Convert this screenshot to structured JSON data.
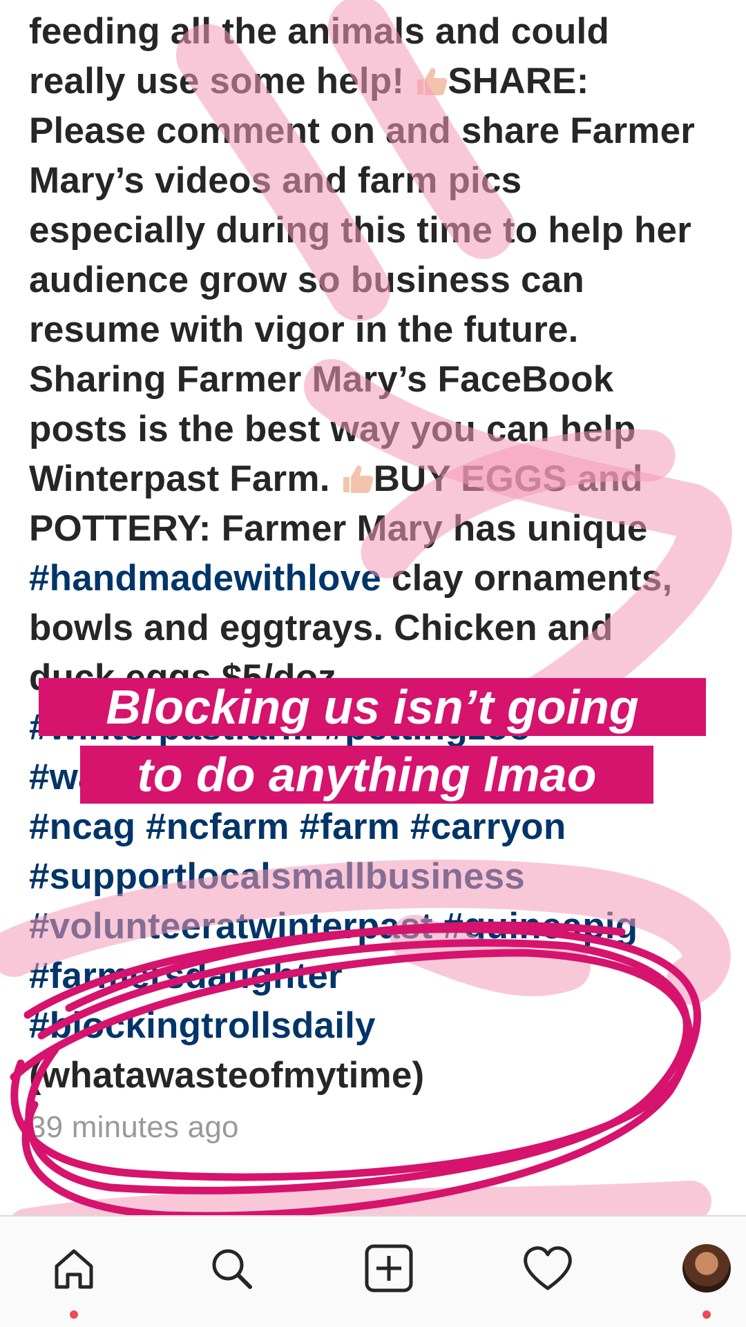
{
  "caption": {
    "lines": [
      [
        {
          "t": "feeding all the animals and could"
        }
      ],
      [
        {
          "t": "really use some help! "
        },
        {
          "emoji": "thumbs-up-icon"
        },
        {
          "t": "SHARE:"
        }
      ],
      [
        {
          "t": "Please comment on and share Farmer"
        }
      ],
      [
        {
          "t": "Mary’s videos and farm pics"
        }
      ],
      [
        {
          "t": "especially during this time to help her"
        }
      ],
      [
        {
          "t": "audience grow so business can"
        }
      ],
      [
        {
          "t": "resume with vigor in the future."
        }
      ],
      [
        {
          "t": "Sharing Farmer Mary’s FaceBook"
        }
      ],
      [
        {
          "t": "posts is the  best way you can help"
        }
      ],
      [
        {
          "t": "Winterpast Farm. "
        },
        {
          "emoji": "thumbs-up-icon"
        },
        {
          "t": "BUY EGGS and"
        }
      ],
      [
        {
          "t": "POTTERY: Farmer Mary has unique"
        }
      ],
      [
        {
          "t": "#handmadewithlove",
          "tag": true
        },
        {
          "t": " clay ornaments,"
        }
      ],
      [
        {
          "t": "bowls and eggtrays. Chicken and"
        }
      ],
      [
        {
          "t": "duck eggs $5/doz"
        }
      ],
      [
        {
          "t": "#winterpastfarm #pettingzoo",
          "tag": true
        }
      ],
      [
        {
          "t": "#wakeforest #farmermary #farmher",
          "tag": true
        }
      ],
      [
        {
          "t": "#ncag #ncfarm #farm #carryon",
          "tag": true
        }
      ],
      [
        {
          "t": "#supportlocalsmallbusiness",
          "tag": true
        }
      ],
      [
        {
          "t": "#volunteeratwinterpast #guineapig",
          "tag": true
        }
      ],
      [
        {
          "t": "#farmersdaughter",
          "tag": true
        }
      ],
      [
        {
          "t": "#blockingtrollsdaily",
          "tag": true
        }
      ],
      [
        {
          "t": "(whatawasteofmytime)"
        }
      ],
      [
        {
          "t": "39 minutes ago",
          "muted": true
        }
      ]
    ]
  },
  "stickers": {
    "line1": "Blocking us isn’t going",
    "line2": "to do anything lmao"
  },
  "tabbar": {
    "items": [
      "home-icon",
      "search-icon",
      "new-post-icon",
      "activity-heart-icon",
      "profile-avatar"
    ]
  },
  "colors": {
    "highlight": "#d6136d",
    "scribble_light": "#f7a6c0",
    "hashtag": "#003569",
    "text": "#262626",
    "notification_dot": "#ed4956"
  }
}
